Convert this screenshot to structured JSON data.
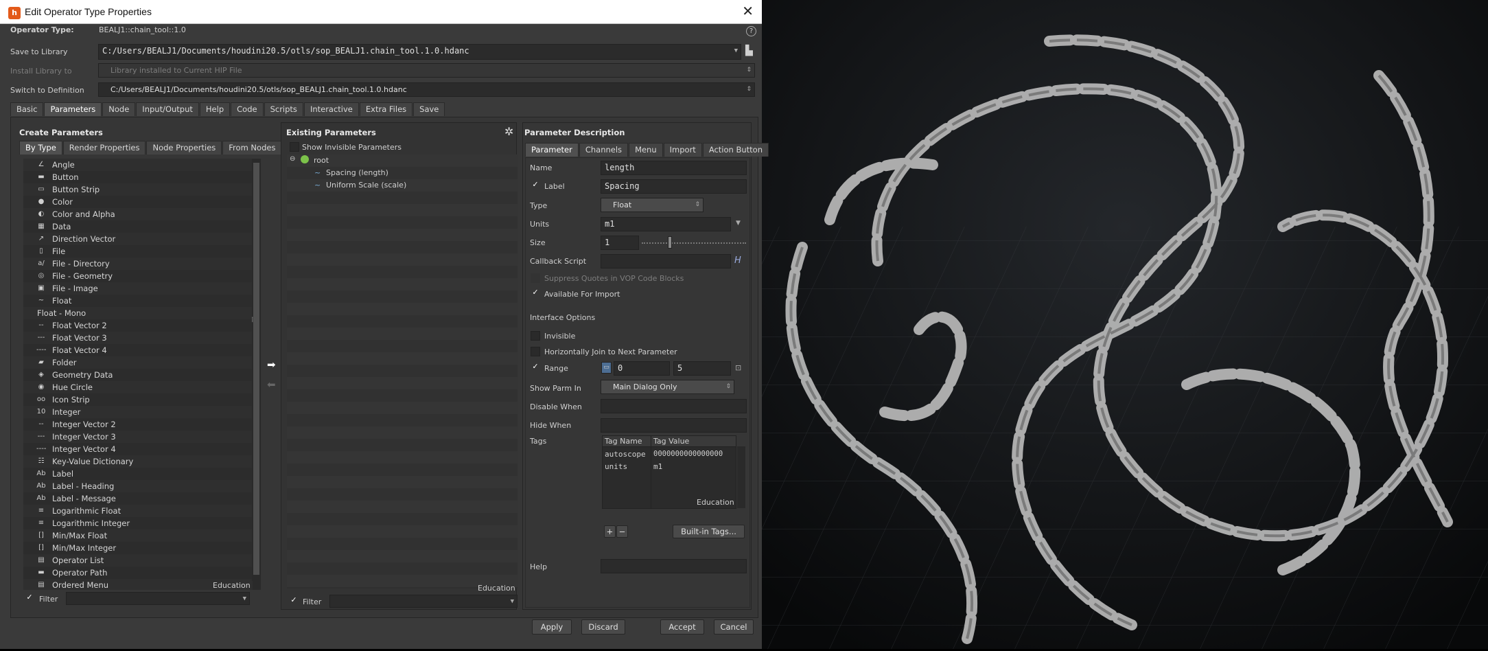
{
  "window": {
    "title": "Edit Operator Type Properties",
    "close": "✕"
  },
  "header": {
    "operator_type_label": "Operator Type:",
    "operator_type_value": "BEALJ1::chain_tool::1.0",
    "help_icon": "?",
    "save_to_library_label": "Save to Library",
    "save_to_library_value": "C:/Users/BEALJ1/Documents/houdini20.5/otls/sop_BEALJ1.chain_tool.1.0.hdanc",
    "install_library_label": "Install Library to",
    "install_library_value": "Library installed to Current HIP File",
    "switch_def_label": "Switch to Definition",
    "switch_def_value": "C:/Users/BEALJ1/Documents/houdini20.5/otls/sop_BEALJ1.chain_tool.1.0.hdanc"
  },
  "main_tabs": [
    {
      "label": "Basic"
    },
    {
      "label": "Parameters"
    },
    {
      "label": "Node"
    },
    {
      "label": "Input/Output"
    },
    {
      "label": "Help"
    },
    {
      "label": "Code"
    },
    {
      "label": "Scripts"
    },
    {
      "label": "Interactive"
    },
    {
      "label": "Extra Files"
    },
    {
      "label": "Save"
    }
  ],
  "create_params": {
    "title": "Create Parameters",
    "tabs": [
      {
        "label": "By Type"
      },
      {
        "label": "Render Properties"
      },
      {
        "label": "Node Properties"
      },
      {
        "label": "From Nodes"
      }
    ],
    "items": [
      {
        "icon": "∠",
        "label": "Angle"
      },
      {
        "icon": "▬",
        "label": "Button"
      },
      {
        "icon": "▭",
        "label": "Button Strip"
      },
      {
        "icon": "●",
        "label": "Color"
      },
      {
        "icon": "◐",
        "label": "Color and Alpha"
      },
      {
        "icon": "▦",
        "label": "Data"
      },
      {
        "icon": "↗",
        "label": "Direction Vector"
      },
      {
        "icon": "▯",
        "label": "File"
      },
      {
        "icon": "a/",
        "label": "File - Directory"
      },
      {
        "icon": "◎",
        "label": "File - Geometry"
      },
      {
        "icon": "▣",
        "label": "File - Image"
      },
      {
        "icon": "~",
        "label": "Float"
      },
      {
        "icon": "",
        "label": "Float - Mono"
      },
      {
        "icon": "--",
        "label": "Float Vector 2"
      },
      {
        "icon": "---",
        "label": "Float Vector 3"
      },
      {
        "icon": "----",
        "label": "Float Vector 4"
      },
      {
        "icon": "▰",
        "label": "Folder"
      },
      {
        "icon": "◈",
        "label": "Geometry Data"
      },
      {
        "icon": "◉",
        "label": "Hue Circle"
      },
      {
        "icon": "oo",
        "label": "Icon Strip"
      },
      {
        "icon": "10",
        "label": "Integer"
      },
      {
        "icon": "--",
        "label": "Integer Vector 2"
      },
      {
        "icon": "---",
        "label": "Integer Vector 3"
      },
      {
        "icon": "----",
        "label": "Integer Vector 4"
      },
      {
        "icon": "☷",
        "label": "Key-Value Dictionary"
      },
      {
        "icon": "Ab",
        "label": "Label"
      },
      {
        "icon": "Ab",
        "label": "Label - Heading"
      },
      {
        "icon": "Ab",
        "label": "Label - Message"
      },
      {
        "icon": "≡",
        "label": "Logarithmic Float"
      },
      {
        "icon": "≡",
        "label": "Logarithmic Integer"
      },
      {
        "icon": "[]",
        "label": "Min/Max Float"
      },
      {
        "icon": "[]",
        "label": "Min/Max Integer"
      },
      {
        "icon": "▤",
        "label": "Operator List"
      },
      {
        "icon": "▬",
        "label": "Operator Path"
      },
      {
        "icon": "▤",
        "label": "Ordered Menu"
      }
    ],
    "education": "Education",
    "filter_label": "Filter"
  },
  "existing_params": {
    "title": "Existing Parameters",
    "show_invisible": "Show Invisible Parameters",
    "tree": {
      "root": "root",
      "children": [
        {
          "label": "Spacing (length)"
        },
        {
          "label": "Uniform Scale (scale)"
        }
      ]
    },
    "education": "Education",
    "filter_label": "Filter"
  },
  "param_desc": {
    "title": "Parameter Description",
    "tabs": [
      {
        "label": "Parameter"
      },
      {
        "label": "Channels"
      },
      {
        "label": "Menu"
      },
      {
        "label": "Import"
      },
      {
        "label": "Action Button"
      }
    ],
    "name_label": "Name",
    "name_value": "length",
    "label_label": "Label",
    "label_value": "Spacing",
    "type_label": "Type",
    "type_value": "Float",
    "units_label": "Units",
    "units_value": "m1",
    "size_label": "Size",
    "size_value": "1",
    "size_slider_fraction": 0.27,
    "callback_label": "Callback Script",
    "callback_value": "",
    "suppress_quotes": "Suppress Quotes in VOP Code Blocks",
    "available_import": "Available For Import",
    "interface_options": "Interface Options",
    "invisible": "Invisible",
    "horiz_join": "Horizontally Join to Next Parameter",
    "range_label": "Range",
    "range_min": "0",
    "range_max": "5",
    "show_parm_label": "Show Parm In",
    "show_parm_value": "Main Dialog Only",
    "disable_when_label": "Disable When",
    "hide_when_label": "Hide When",
    "tags_label": "Tags",
    "tag_headers": [
      "Tag Name",
      "Tag Value"
    ],
    "tags": [
      {
        "name": "autoscope",
        "value": "0000000000000000"
      },
      {
        "name": "units",
        "value": "m1"
      }
    ],
    "tags_education": "Education",
    "add": "+",
    "remove": "−",
    "builtin_tags": "Built-in Tags...",
    "help_label": "Help"
  },
  "footer": {
    "apply": "Apply",
    "discard": "Discard",
    "accept": "Accept",
    "cancel": "Cancel"
  },
  "colors": {
    "accent": "#e35a1a",
    "bg": "#3a3a3a",
    "field": "#2b2b2b"
  }
}
